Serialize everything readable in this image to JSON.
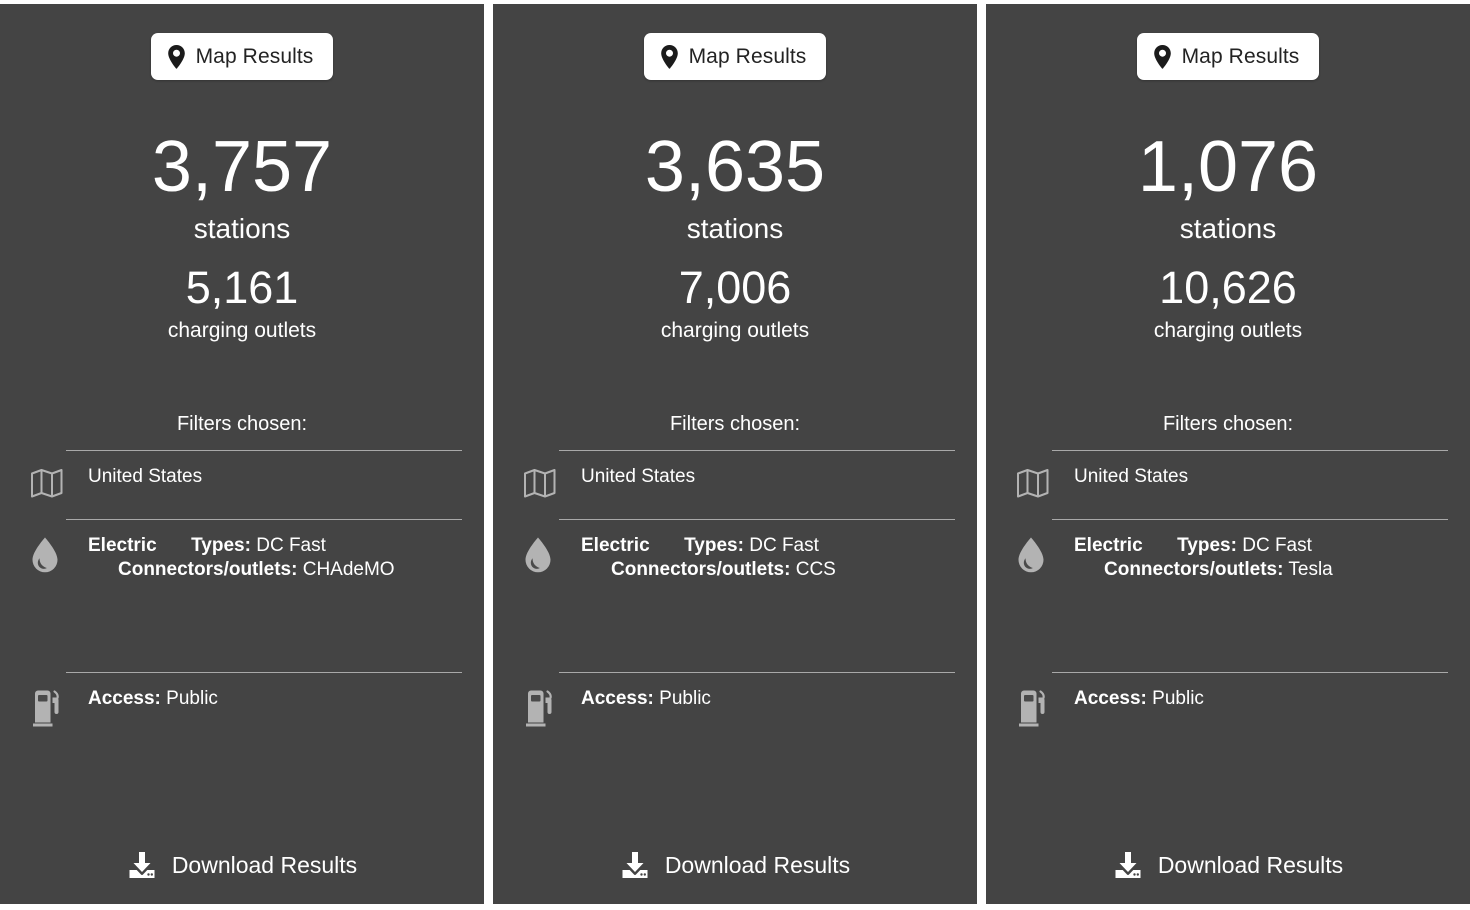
{
  "theme": {
    "panel_background": "#444444",
    "page_background": "#ffffff",
    "text_color": "#ffffff",
    "divider_color": "#a9a9a9",
    "icon_color": "#b3b3b3",
    "button_background": "#ffffff",
    "button_text_color": "#232323"
  },
  "common": {
    "map_results_label": "Map Results",
    "stations_label": "stations",
    "outlets_label": "charging outlets",
    "filters_title": "Filters chosen:",
    "download_label": "Download Results",
    "types_key": "Types:",
    "connectors_key": "Connectors/outlets:",
    "access_key": "Access:",
    "pin_icon": "map-pin-icon",
    "region_icon": "folded-map-icon",
    "fuel_icon": "fuel-droplet-icon",
    "access_icon": "fuel-pump-icon",
    "download_icon": "download-icon"
  },
  "panels": [
    {
      "id": "panel-chademo",
      "map_results_label": "Map Results",
      "stations_count": "3,757",
      "stations_label": "stations",
      "outlets_count": "5,161",
      "outlets_label": "charging outlets",
      "filters_title": "Filters chosen:",
      "region": "United States",
      "fuel_type": "Electric",
      "types_key": "Types:",
      "types_value": "DC Fast",
      "connectors_key": "Connectors/outlets:",
      "connectors_value": "CHAdeMO",
      "access_key": "Access:",
      "access_value": "Public",
      "download_label": "Download Results"
    },
    {
      "id": "panel-ccs",
      "map_results_label": "Map Results",
      "stations_count": "3,635",
      "stations_label": "stations",
      "outlets_count": "7,006",
      "outlets_label": "charging outlets",
      "filters_title": "Filters chosen:",
      "region": "United States",
      "fuel_type": "Electric",
      "types_key": "Types:",
      "types_value": "DC Fast",
      "connectors_key": "Connectors/outlets:",
      "connectors_value": "CCS",
      "access_key": "Access:",
      "access_value": "Public",
      "download_label": "Download Results"
    },
    {
      "id": "panel-tesla",
      "map_results_label": "Map Results",
      "stations_count": "1,076",
      "stations_label": "stations",
      "outlets_count": "10,626",
      "outlets_label": "charging outlets",
      "filters_title": "Filters chosen:",
      "region": "United States",
      "fuel_type": "Electric",
      "types_key": "Types:",
      "types_value": "DC Fast",
      "connectors_key": "Connectors/outlets:",
      "connectors_value": "Tesla",
      "access_key": "Access:",
      "access_value": "Public",
      "download_label": "Download Results"
    }
  ]
}
